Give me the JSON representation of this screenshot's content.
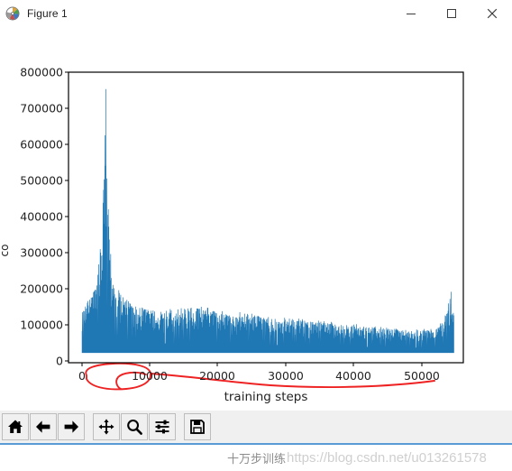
{
  "window": {
    "title": "Figure 1",
    "icon": "matplotlib-icon",
    "minimize_label": "–",
    "maximize_label": "□",
    "close_label": "✕"
  },
  "toolbar": {
    "buttons": [
      {
        "name": "home-icon",
        "tooltip": "Home"
      },
      {
        "name": "back-arrow-icon",
        "tooltip": "Back"
      },
      {
        "name": "forward-arrow-icon",
        "tooltip": "Forward"
      },
      {
        "name": "pan-move-icon",
        "tooltip": "Pan"
      },
      {
        "name": "zoom-magnifier-icon",
        "tooltip": "Zoom"
      },
      {
        "name": "configure-subplots-icon",
        "tooltip": "Subplots"
      },
      {
        "name": "save-floppy-icon",
        "tooltip": "Save"
      }
    ]
  },
  "watermark": {
    "chinese": "十万步训练",
    "url": "https://blog.csdn.net/u013261578"
  },
  "chart_data": {
    "type": "line",
    "title": "",
    "xlabel": "training steps",
    "ylabel": "cost",
    "ylabel_clipped": true,
    "xlim": [
      -2000,
      56000
    ],
    "ylim": [
      -30000,
      830000
    ],
    "xticks": [
      0,
      10000,
      20000,
      30000,
      40000,
      50000
    ],
    "xticklabels": [
      "0",
      "10000",
      "20000",
      "30000",
      "40000",
      "50000"
    ],
    "yticks": [
      0,
      100000,
      200000,
      300000,
      400000,
      500000,
      600000,
      700000,
      800000
    ],
    "yticklabels": [
      "0",
      "100000",
      "200000",
      "300000",
      "400000",
      "500000",
      "600000",
      "700000",
      "800000"
    ],
    "grid": false,
    "legend": null,
    "line_color": "#1f77b4",
    "series": [
      {
        "name": "cost",
        "description": "Noisy training cost per step: moderate noise at start, a single dominant spike near step 3500 reaching about 780000, rapid decay to a broad noisy band that decreases from about 130000 to about 60000, and a final spike near step 54000 reaching about 180000.",
        "envelope_x": [
          0,
          500,
          1000,
          1500,
          2000,
          2500,
          3000,
          3300,
          3500,
          3700,
          4000,
          4500,
          5000,
          6000,
          7000,
          8000,
          9000,
          10000,
          12000,
          14000,
          16000,
          18000,
          20000,
          22000,
          24000,
          26000,
          28000,
          30000,
          32000,
          34000,
          36000,
          38000,
          40000,
          42000,
          44000,
          46000,
          48000,
          50000,
          52000,
          53000,
          53800,
          54200,
          54600
        ],
        "envelope_max": [
          120000,
          145000,
          160000,
          175000,
          200000,
          260000,
          420000,
          640000,
          780000,
          560000,
          330000,
          230000,
          190000,
          165000,
          150000,
          140000,
          132000,
          128000,
          122000,
          130000,
          135000,
          128000,
          120000,
          112000,
          116000,
          108000,
          100000,
          104000,
          96000,
          92000,
          88000,
          84000,
          80000,
          76000,
          74000,
          70000,
          68000,
          66000,
          72000,
          90000,
          150000,
          180000,
          120000
        ],
        "envelope_min": [
          0,
          0,
          0,
          0,
          0,
          0,
          0,
          0,
          0,
          0,
          0,
          0,
          0,
          0,
          0,
          0,
          0,
          0,
          0,
          0,
          0,
          0,
          0,
          0,
          0,
          0,
          0,
          0,
          0,
          0,
          0,
          0,
          0,
          0,
          0,
          0,
          0,
          0,
          0,
          0,
          0,
          0,
          0
        ],
        "peak": {
          "x": 3500,
          "y": 780000
        },
        "end_spike": {
          "x": 54200,
          "y": 180000
        }
      }
    ],
    "annotations": [
      {
        "name": "red-ellipse-annotation",
        "shape": "ellipse",
        "color": "#ee2222",
        "note": "Hand-drawn red ellipse circling the low-cost baseline between about step 1500 and step 9500."
      },
      {
        "name": "red-squiggle-annotation",
        "shape": "hook",
        "color": "#ee2222",
        "note": "Small hand-drawn hook stroke inside the ellipse."
      },
      {
        "name": "red-sweep-curve-annotation",
        "shape": "curve",
        "color": "#ee2222",
        "note": "Long red curve sweeping right from the ellipse along the baseline, dipping slightly then rising near the right edge."
      }
    ]
  }
}
